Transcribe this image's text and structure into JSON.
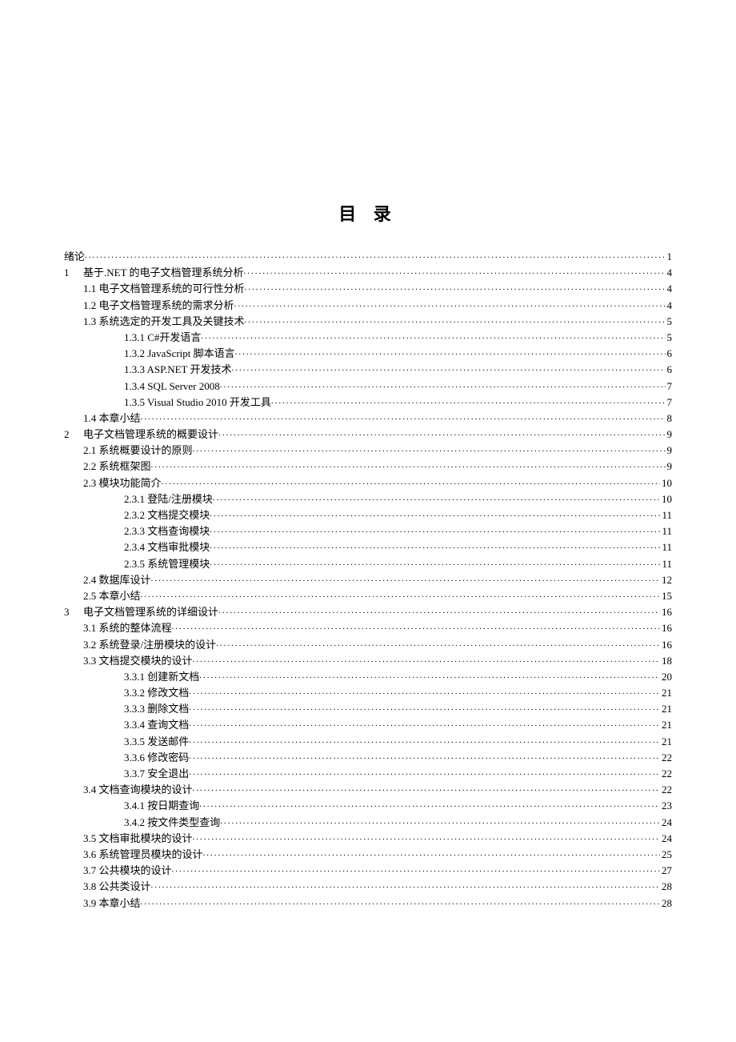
{
  "title": "目 录",
  "entries": [
    {
      "level": 0,
      "label": "绪论",
      "page": "1"
    },
    {
      "level": 1,
      "num": "1",
      "label": "基于.NET 的电子文档管理系统分析",
      "page": "4"
    },
    {
      "level": 2,
      "label": "1.1 电子文档管理系统的可行性分析",
      "page": "4"
    },
    {
      "level": 2,
      "label": "1.2 电子文档管理系统的需求分析",
      "page": "4"
    },
    {
      "level": 2,
      "label": "1.3 系统选定的开发工具及关键技术",
      "page": "5"
    },
    {
      "level": 3,
      "label": "1.3.1 C#开发语言",
      "page": "5"
    },
    {
      "level": 3,
      "label": "1.3.2 JavaScript 脚本语言",
      "page": "6"
    },
    {
      "level": 3,
      "label": "1.3.3 ASP.NET 开发技术",
      "page": "6"
    },
    {
      "level": 3,
      "label": "1.3.4 SQL Server 2008",
      "page": "7"
    },
    {
      "level": 3,
      "label": "1.3.5 Visual Studio 2010 开发工具",
      "page": "7"
    },
    {
      "level": 2,
      "label": "1.4 本章小结",
      "page": "8"
    },
    {
      "level": 1,
      "num": "2",
      "label": "电子文档管理系统的概要设计",
      "page": "9"
    },
    {
      "level": 2,
      "label": "2.1 系统概要设计的原则",
      "page": "9"
    },
    {
      "level": 2,
      "label": "2.2 系统框架图",
      "page": "9"
    },
    {
      "level": 2,
      "label": "2.3 模块功能简介",
      "page": "10"
    },
    {
      "level": 3,
      "label": "2.3.1 登陆/注册模块",
      "page": "10"
    },
    {
      "level": 3,
      "label": "2.3.2 文档提交模块",
      "page": "11"
    },
    {
      "level": 3,
      "label": "2.3.3 文档查询模块",
      "page": "11"
    },
    {
      "level": 3,
      "label": "2.3.4 文档审批模块",
      "page": "11"
    },
    {
      "level": 3,
      "label": "2.3.5 系统管理模块",
      "page": "11"
    },
    {
      "level": 2,
      "label": "2.4 数据库设计",
      "page": "12"
    },
    {
      "level": 2,
      "label": "2.5  本章小结",
      "page": "15"
    },
    {
      "level": 1,
      "num": "3",
      "label": "电子文档管理系统的详细设计",
      "page": "16"
    },
    {
      "level": 2,
      "label": "3.1 系统的整体流程",
      "page": "16"
    },
    {
      "level": 2,
      "label": "3.2 系统登录/注册模块的设计",
      "page": "16"
    },
    {
      "level": 2,
      "label": "3.3 文档提交模块的设计",
      "page": "18"
    },
    {
      "level": 3,
      "label": "3.3.1 创建新文档",
      "page": "20"
    },
    {
      "level": 3,
      "label": "3.3.2 修改文档",
      "page": "21"
    },
    {
      "level": 3,
      "label": "3.3.3 删除文档",
      "page": "21"
    },
    {
      "level": 3,
      "label": "3.3.4 查询文档",
      "page": "21"
    },
    {
      "level": 3,
      "label": "3.3.5 发送邮件",
      "page": "21"
    },
    {
      "level": 3,
      "label": "3.3.6 修改密码",
      "page": "22"
    },
    {
      "level": 3,
      "label": "3.3.7 安全退出",
      "page": "22"
    },
    {
      "level": 2,
      "label": "3.4 文档查询模块的设计",
      "page": "22"
    },
    {
      "level": 3,
      "label": "3.4.1 按日期查询",
      "page": "23"
    },
    {
      "level": 3,
      "label": "3.4.2 按文件类型查询",
      "page": "24"
    },
    {
      "level": 2,
      "label": "3.5 文档审批模块的设计",
      "page": "24"
    },
    {
      "level": 2,
      "label": "3.6 系统管理员模块的设计",
      "page": "25"
    },
    {
      "level": 2,
      "label": "3.7 公共模块的设计",
      "page": "27"
    },
    {
      "level": 2,
      "label": "3.8 公共类设计",
      "page": "28"
    },
    {
      "level": 2,
      "label": "3.9 本章小结",
      "page": "28"
    }
  ]
}
